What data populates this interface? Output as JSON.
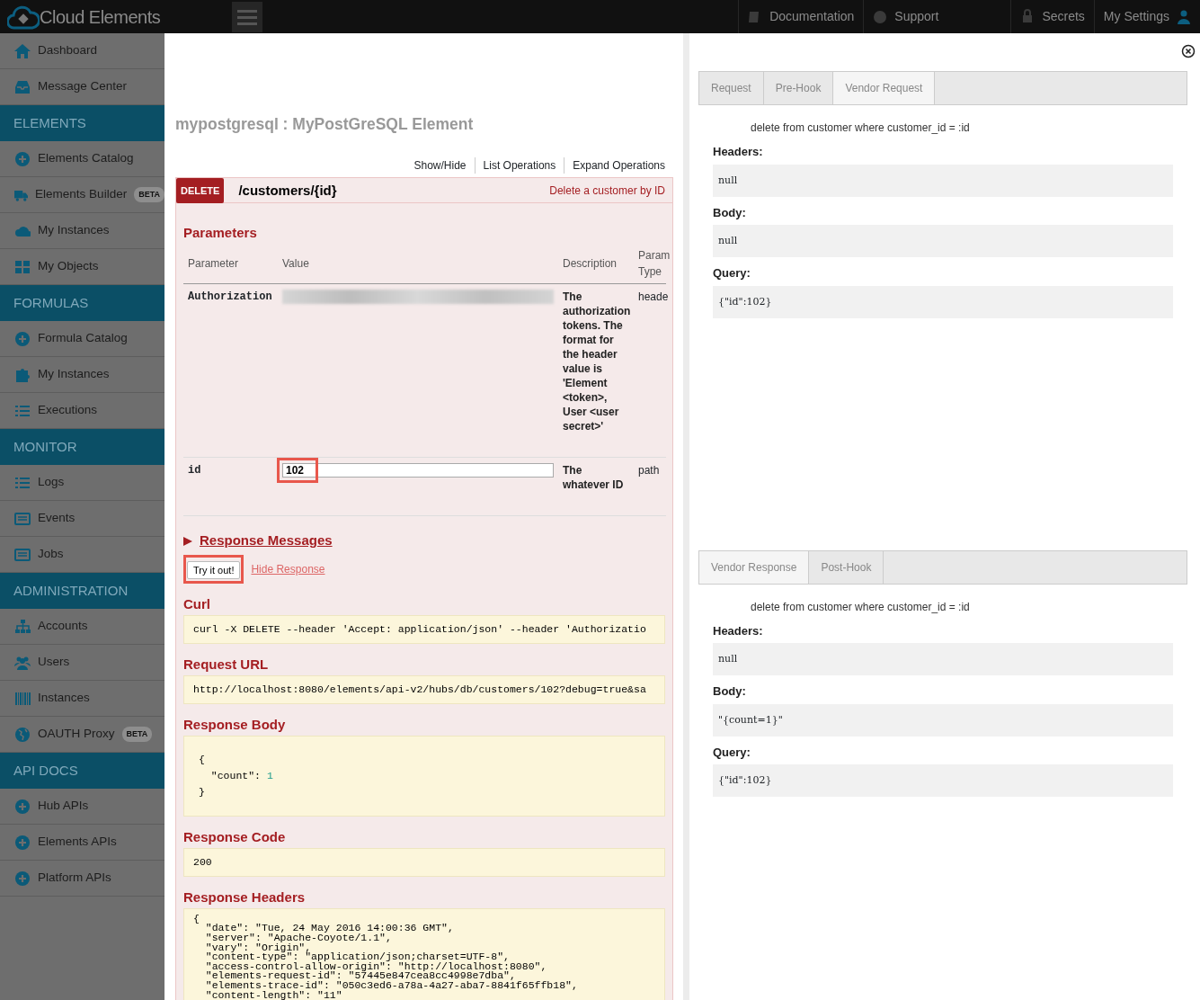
{
  "topbar": {
    "brand": "Cloud Elements",
    "links": [
      {
        "label": "Documentation"
      },
      {
        "label": "Support"
      },
      {
        "label": "Secrets"
      },
      {
        "label": "My Settings"
      }
    ]
  },
  "sidebar": [
    {
      "kind": "item",
      "label": "Dashboard"
    },
    {
      "kind": "item",
      "label": "Message Center"
    },
    {
      "kind": "section",
      "label": "ELEMENTS"
    },
    {
      "kind": "item",
      "label": "Elements Catalog"
    },
    {
      "kind": "item",
      "label": "Elements Builder",
      "badge": "BETA"
    },
    {
      "kind": "item",
      "label": "My Instances"
    },
    {
      "kind": "item",
      "label": "My Objects"
    },
    {
      "kind": "section",
      "label": "FORMULAS"
    },
    {
      "kind": "item",
      "label": "Formula Catalog"
    },
    {
      "kind": "item",
      "label": "My Instances"
    },
    {
      "kind": "item",
      "label": "Executions"
    },
    {
      "kind": "section",
      "label": "MONITOR"
    },
    {
      "kind": "item",
      "label": "Logs"
    },
    {
      "kind": "item",
      "label": "Events"
    },
    {
      "kind": "item",
      "label": "Jobs"
    },
    {
      "kind": "section",
      "label": "ADMINISTRATION"
    },
    {
      "kind": "item",
      "label": "Accounts"
    },
    {
      "kind": "item",
      "label": "Users"
    },
    {
      "kind": "item",
      "label": "Instances"
    },
    {
      "kind": "item",
      "label": "OAUTH Proxy",
      "badge": "BETA"
    },
    {
      "kind": "section",
      "label": "API DOCS"
    },
    {
      "kind": "item",
      "label": "Hub APIs"
    },
    {
      "kind": "item",
      "label": "Elements APIs"
    },
    {
      "kind": "item",
      "label": "Platform APIs"
    }
  ],
  "api": {
    "title": "mypostgresql : MyPostGreSQL Element",
    "links": [
      "Show/Hide",
      "List Operations",
      "Expand Operations"
    ],
    "operation": {
      "method": "DELETE",
      "path": "/customers/{id}",
      "summary": "Delete a customer by ID",
      "parameters_title": "Parameters",
      "columns": [
        "Parameter",
        "Value",
        "Description",
        "Param Type"
      ],
      "parameters": [
        {
          "name": "Authorization",
          "description": "The authorization tokens. The format for the header value is 'Element <token>, User <user secret>'",
          "type": "heade"
        },
        {
          "name": "id",
          "value": "102",
          "description": "The whatever ID",
          "type": "path"
        }
      ],
      "response_messages": "Response Messages",
      "try_button": "Try it out!",
      "hide_link": "Hide Response",
      "sections": [
        {
          "title": "Curl",
          "kind": "line",
          "text": "curl -X DELETE --header 'Accept: application/json' --header 'Authorizatio"
        },
        {
          "title": "Request URL",
          "kind": "line",
          "text": "http://localhost:8080/elements/api-v2/hubs/db/customers/102?debug=true&sa"
        },
        {
          "title": "Response Body",
          "kind": "json",
          "text": "{\n  \"count\": 1\n}"
        },
        {
          "title": "Response Code",
          "kind": "line",
          "text": "200"
        },
        {
          "title": "Response Headers",
          "kind": "headers",
          "text": "{\n  \"date\": \"Tue, 24 May 2016 14:00:36 GMT\",\n  \"server\": \"Apache-Coyote/1.1\",\n  \"vary\": \"Origin\",\n  \"content-type\": \"application/json;charset=UTF-8\",\n  \"access-control-allow-origin\": \"http://localhost:8080\",\n  \"elements-request-id\": \"57445e847cea8cc4998e7dba\",\n  \"elements-trace-id\": \"050c3ed6-a78a-4a27-aba7-8841f65ffb18\",\n  \"content-length\": \"11\""
        }
      ]
    }
  },
  "panels": [
    {
      "tabs": [
        {
          "label": "Request",
          "selected": false
        },
        {
          "label": "Pre-Hook",
          "selected": false
        },
        {
          "label": "Vendor Request",
          "selected": true
        }
      ],
      "statement": "delete from customer where customer_id = :id",
      "fields": [
        {
          "label": "Headers:",
          "value": "null"
        },
        {
          "label": "Body:",
          "value": "null"
        },
        {
          "label": "Query:",
          "value": "{\"id\":102}"
        }
      ]
    },
    {
      "tabs": [
        {
          "label": "Vendor Response",
          "selected": true
        },
        {
          "label": "Post-Hook",
          "selected": false
        }
      ],
      "statement": "delete from customer where customer_id = :id",
      "fields": [
        {
          "label": "Headers:",
          "value": "null"
        },
        {
          "label": "Body:",
          "value": "\"{count=1}\""
        },
        {
          "label": "Query:",
          "value": "{\"id\":102}"
        }
      ]
    }
  ]
}
